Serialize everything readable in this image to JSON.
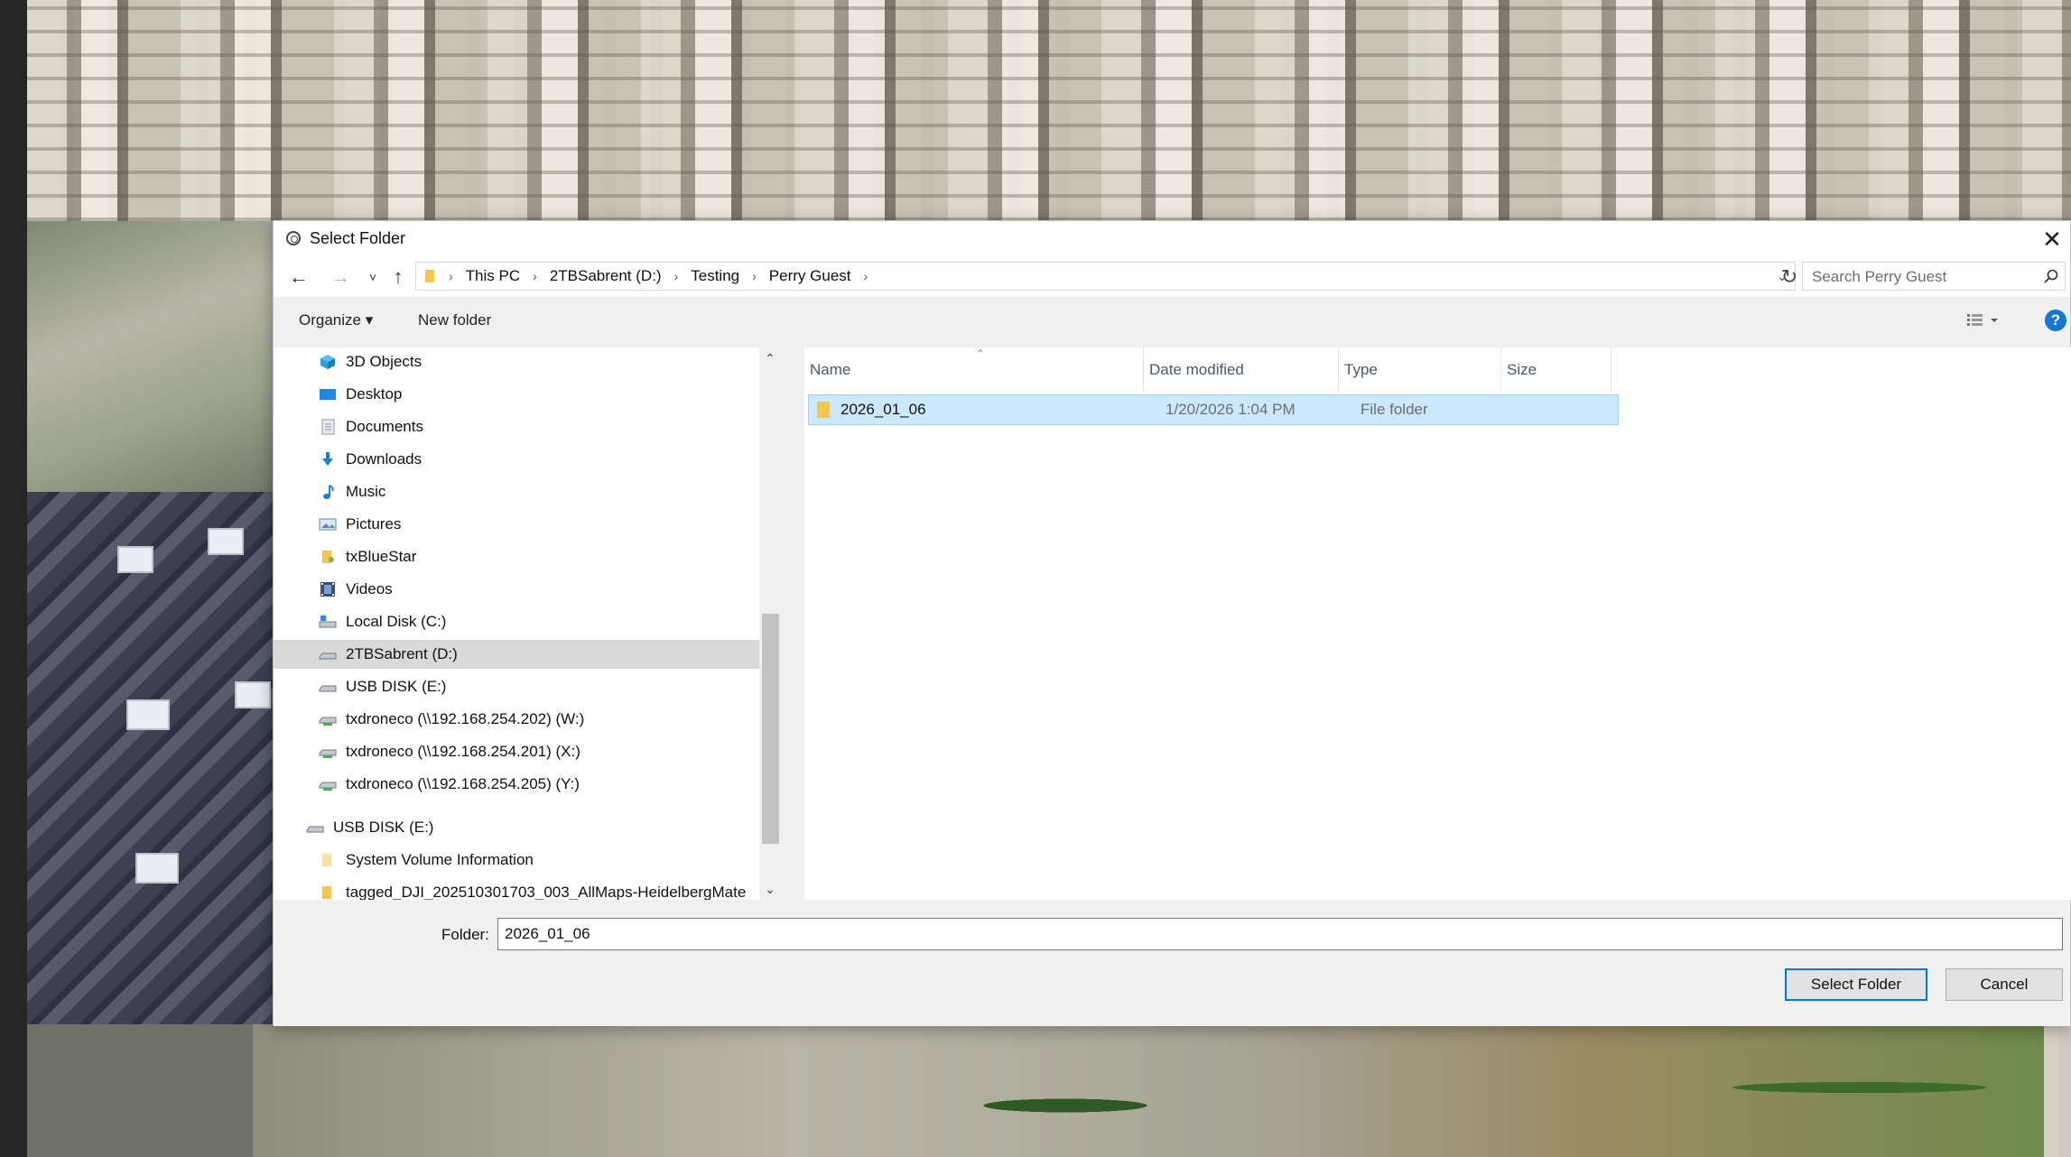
{
  "dialog": {
    "title": "Select Folder",
    "close_glyph": "✕"
  },
  "address": {
    "back_glyph": "←",
    "forward_glyph": "→",
    "recent_glyph": "˅",
    "up_glyph": "↑",
    "crumbs": [
      "This PC",
      "2TBSabrent (D:)",
      "Testing",
      "Perry Guest"
    ],
    "refresh_glyph": "↻",
    "search_placeholder": "Search Perry Guest"
  },
  "toolbar": {
    "organize_label": "Organize ▾",
    "new_folder_label": "New folder",
    "help_label": "?"
  },
  "nav": {
    "items": [
      {
        "label": "3D Objects",
        "icon": "3d-objects-icon"
      },
      {
        "label": "Desktop",
        "icon": "desktop-icon"
      },
      {
        "label": "Documents",
        "icon": "documents-icon"
      },
      {
        "label": "Downloads",
        "icon": "downloads-icon"
      },
      {
        "label": "Music",
        "icon": "music-icon"
      },
      {
        "label": "Pictures",
        "icon": "pictures-icon"
      },
      {
        "label": "txBlueStar",
        "icon": "user-folder-icon"
      },
      {
        "label": "Videos",
        "icon": "videos-icon"
      },
      {
        "label": "Local Disk (C:)",
        "icon": "local-disk-icon"
      },
      {
        "label": "2TBSabrent (D:)",
        "icon": "drive-icon",
        "selected": true
      },
      {
        "label": "USB DISK (E:)",
        "icon": "usb-drive-icon"
      },
      {
        "label": "txdroneco (\\\\192.168.254.202) (W:)",
        "icon": "network-drive-icon"
      },
      {
        "label": "txdroneco (\\\\192.168.254.201) (X:)",
        "icon": "network-drive-icon"
      },
      {
        "label": "txdroneco (\\\\192.168.254.205) (Y:)",
        "icon": "network-drive-icon"
      },
      {
        "label": "USB DISK (E:)",
        "icon": "usb-drive-icon"
      },
      {
        "label": "System Volume Information",
        "icon": "folder-icon"
      },
      {
        "label": "tagged_DJI_202510301703_003_AllMaps-HeidelbergMate",
        "icon": "folder-icon"
      }
    ]
  },
  "files": {
    "columns": [
      "Name",
      "Date modified",
      "Type",
      "Size"
    ],
    "rows": [
      {
        "name": "2026_01_06",
        "date": "1/20/2026 1:04 PM",
        "type": "File folder",
        "size": ""
      }
    ]
  },
  "bottom": {
    "folder_label": "Folder:",
    "folder_value": "2026_01_06",
    "select_label": "Select Folder",
    "cancel_label": "Cancel"
  },
  "colors": {
    "selection_bg": "#cce8ff",
    "selection_border": "#99d1ff",
    "accent": "#0078d7",
    "folder": "#f3c64f"
  }
}
